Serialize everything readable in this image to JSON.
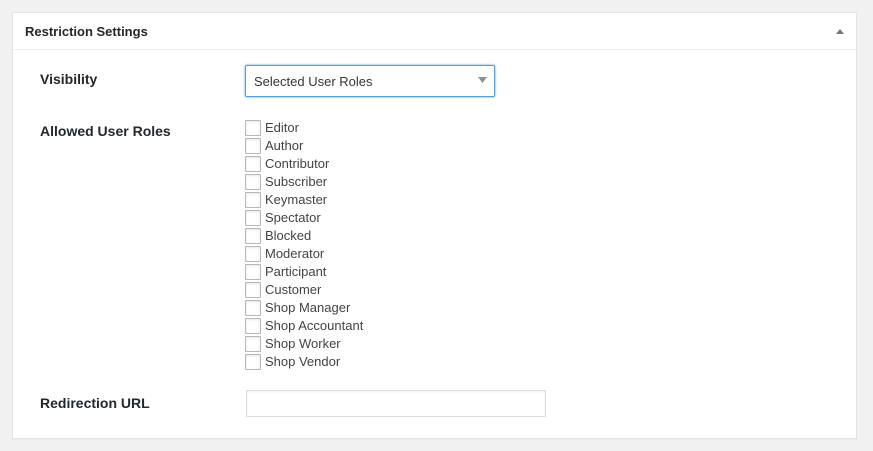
{
  "panel": {
    "title": "Restriction Settings",
    "toggle_icon": "triangle-up-icon"
  },
  "visibility": {
    "label": "Visibility",
    "selected_value": "Selected User Roles",
    "arrow_icon": "chevron-down-icon"
  },
  "roles": {
    "label": "Allowed User Roles",
    "items": [
      {
        "label": "Editor",
        "checked": false
      },
      {
        "label": "Author",
        "checked": false
      },
      {
        "label": "Contributor",
        "checked": false
      },
      {
        "label": "Subscriber",
        "checked": false
      },
      {
        "label": "Keymaster",
        "checked": false
      },
      {
        "label": "Spectator",
        "checked": false
      },
      {
        "label": "Blocked",
        "checked": false
      },
      {
        "label": "Moderator",
        "checked": false
      },
      {
        "label": "Participant",
        "checked": false
      },
      {
        "label": "Customer",
        "checked": false
      },
      {
        "label": "Shop Manager",
        "checked": false
      },
      {
        "label": "Shop Accountant",
        "checked": false
      },
      {
        "label": "Shop Worker",
        "checked": false
      },
      {
        "label": "Shop Vendor",
        "checked": false
      }
    ]
  },
  "redirection": {
    "label": "Redirection URL",
    "value": ""
  },
  "colors": {
    "focus_border": "#5b9dd9",
    "panel_bg": "#ffffff",
    "page_bg": "#f1f1f1"
  }
}
